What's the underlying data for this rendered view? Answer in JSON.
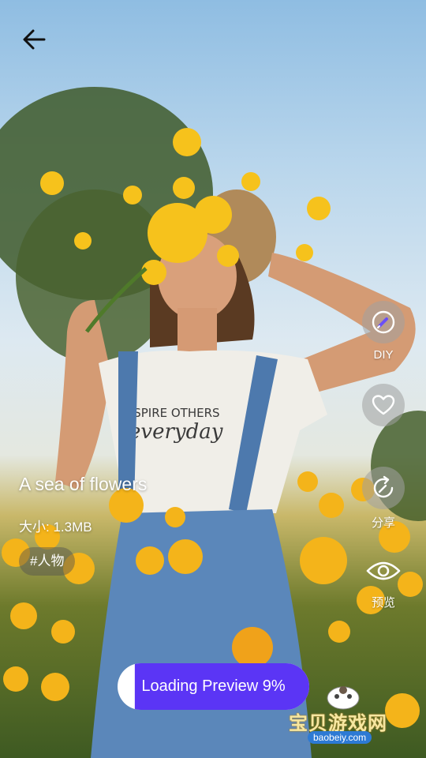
{
  "wallpaper": {
    "title": "A sea of flowers",
    "size_text": "大小: 1.3MB",
    "tag": "#人物"
  },
  "actions": {
    "diy_label": "DIY",
    "share_label": "分享",
    "preview_label": "预览"
  },
  "loading": {
    "label": "Loading Preview 9%",
    "progress_percent": 9
  },
  "watermark": {
    "site_name": "宝贝游戏网",
    "site_url": "baobeiy.com"
  },
  "colors": {
    "accent": "#5b35f5"
  },
  "icons": {
    "back": "arrow-left-icon",
    "diy": "pen-icon",
    "like": "heart-icon",
    "share": "share-icon",
    "preview": "eye-icon"
  }
}
